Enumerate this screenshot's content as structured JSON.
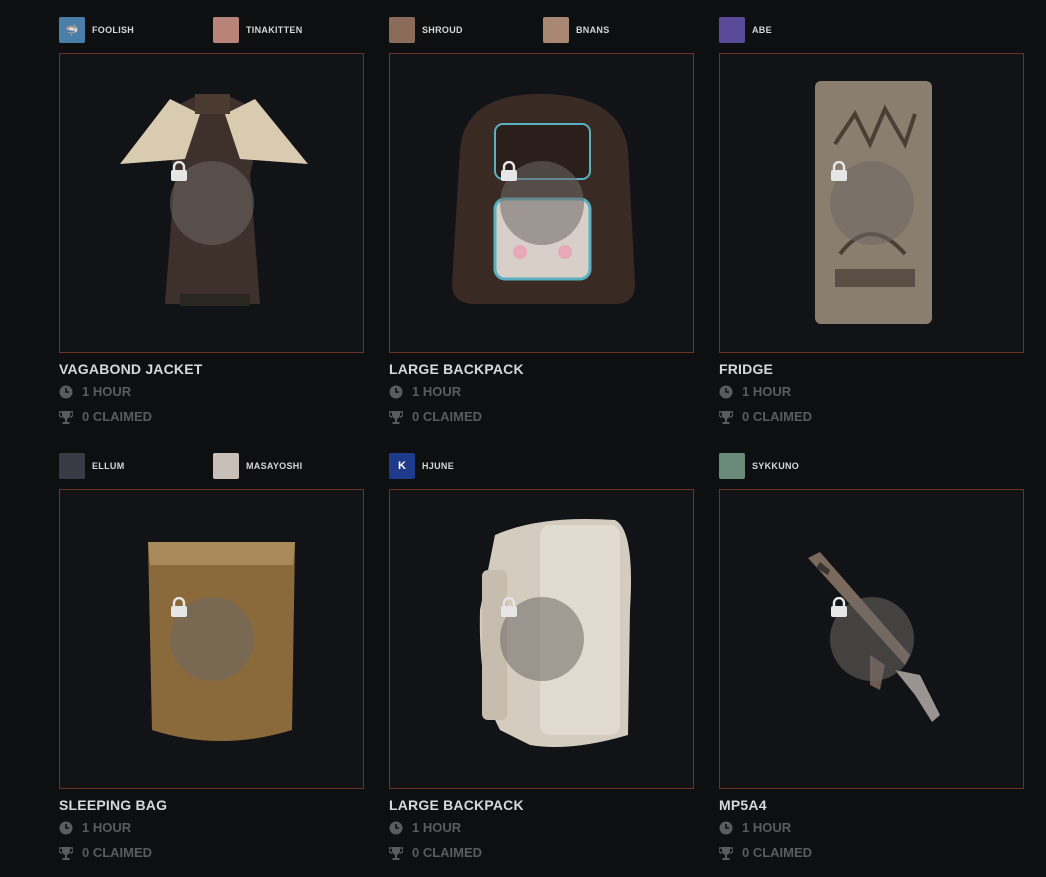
{
  "colors": {
    "background": "#0e0f11",
    "frame_border": "#6a3324",
    "muted_text": "#585b60"
  },
  "drops": [
    {
      "name": "VAGABOND JACKET",
      "duration": "1 HOUR",
      "claimed": "0 CLAIMED",
      "locked": true,
      "streamers": [
        {
          "name": "FOOLISH",
          "avatar_color": "#4a7ea8"
        },
        {
          "name": "TINAKITTEN",
          "avatar_color": "#b8847a"
        }
      ]
    },
    {
      "name": "LARGE BACKPACK",
      "duration": "1 HOUR",
      "claimed": "0 CLAIMED",
      "locked": true,
      "streamers": [
        {
          "name": "SHROUD",
          "avatar_color": "#8a6a58"
        },
        {
          "name": "BNANS",
          "avatar_color": "#a88872"
        }
      ]
    },
    {
      "name": "FRIDGE",
      "duration": "1 HOUR",
      "claimed": "0 CLAIMED",
      "locked": true,
      "streamers": [
        {
          "name": "ABE",
          "avatar_color": "#5a4a9a"
        }
      ]
    },
    {
      "name": "SLEEPING BAG",
      "duration": "1 HOUR",
      "claimed": "0 CLAIMED",
      "locked": true,
      "streamers": [
        {
          "name": "ELLUM",
          "avatar_color": "#3a3a44"
        },
        {
          "name": "MASAYOSHI",
          "avatar_color": "#c8c0b8"
        }
      ]
    },
    {
      "name": "LARGE BACKPACK",
      "duration": "1 HOUR",
      "claimed": "0 CLAIMED",
      "locked": true,
      "streamers": [
        {
          "name": "HJUNE",
          "avatar_color": "#1e3a8a"
        }
      ]
    },
    {
      "name": "MP5A4",
      "duration": "1 HOUR",
      "claimed": "0 CLAIMED",
      "locked": true,
      "streamers": [
        {
          "name": "SYKKUNO",
          "avatar_color": "#6a8a7a"
        }
      ]
    }
  ]
}
